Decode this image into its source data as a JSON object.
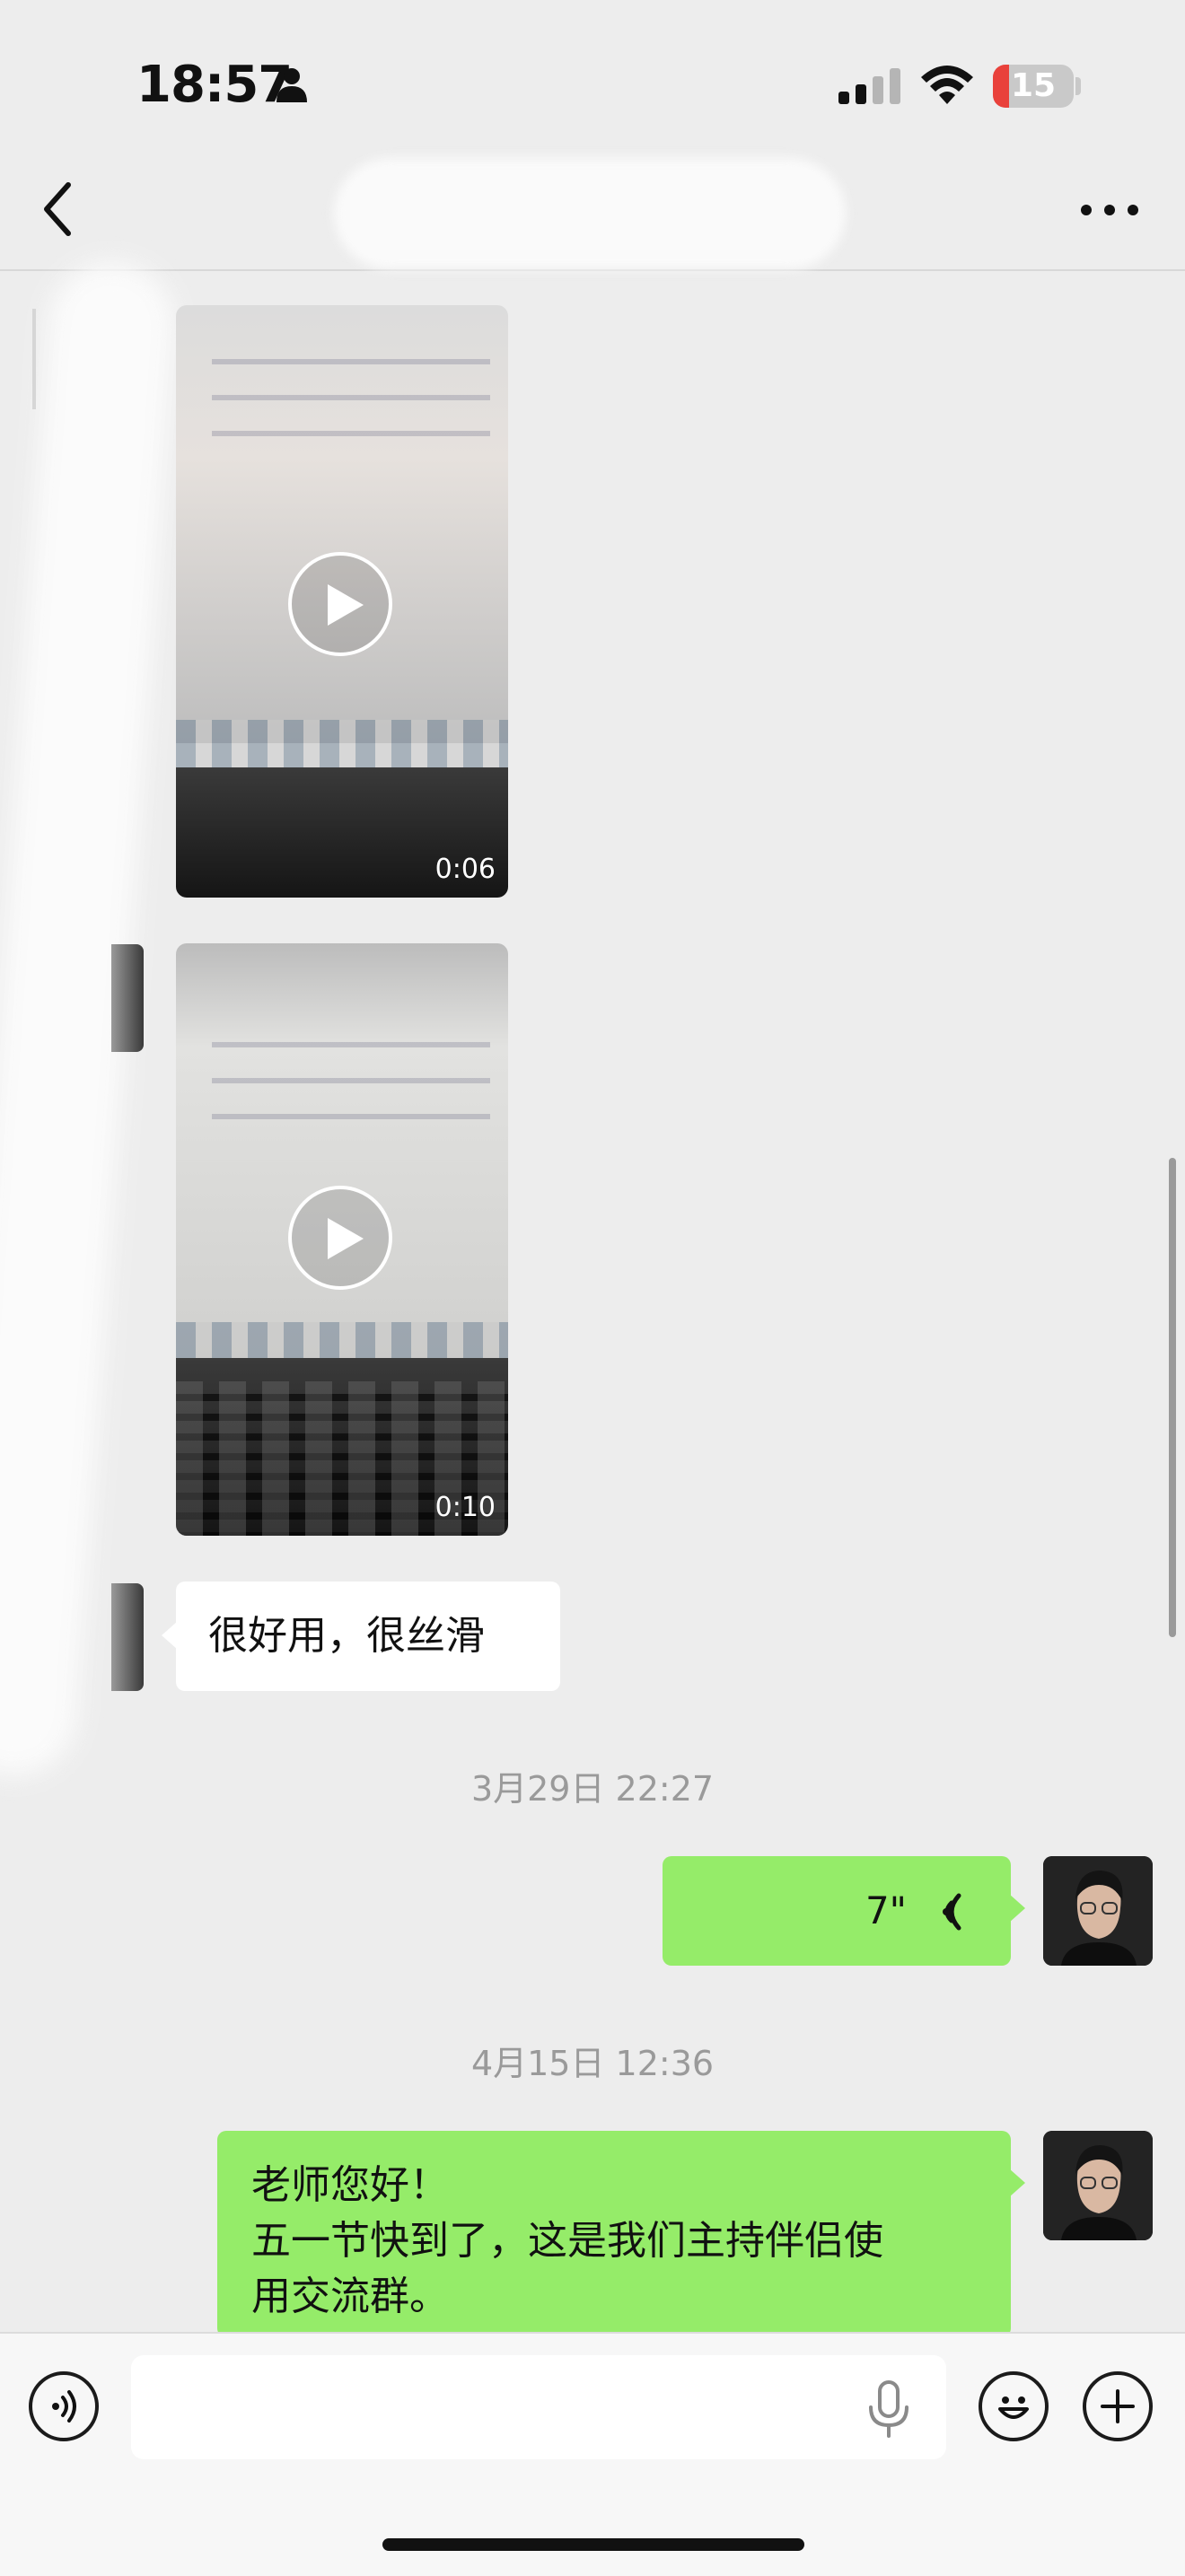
{
  "status_bar": {
    "time": "18:57",
    "battery": "15",
    "icons": [
      "person-icon",
      "signal-icon",
      "wifi-icon",
      "battery-icon"
    ]
  },
  "nav": {
    "back_icon": "chevron-left-icon",
    "more_icon": "ellipsis-icon"
  },
  "messages": [
    {
      "type": "video",
      "side": "left",
      "duration": "0:06"
    },
    {
      "type": "video",
      "side": "left",
      "duration": "0:10"
    },
    {
      "type": "text",
      "side": "left",
      "text": "很好用，很丝滑"
    }
  ],
  "timestamps": [
    "3月29日 22:27",
    "4月15日 12:36"
  ],
  "voice_message": {
    "side": "right",
    "duration": "7\""
  },
  "outgoing_text": {
    "line1": "老师您好！",
    "line2": "五一节快到了，这是我们主持伴侣使",
    "line3": "用交流群。"
  },
  "input_bar": {
    "voice_icon": "voice-mode-icon",
    "mic_icon": "microphone-icon",
    "emoji_icon": "emoji-icon",
    "plus_icon": "plus-icon",
    "value": ""
  },
  "colors": {
    "background": "#ededed",
    "green_bubble": "#95ec69",
    "battery_low": "#e9413b"
  }
}
